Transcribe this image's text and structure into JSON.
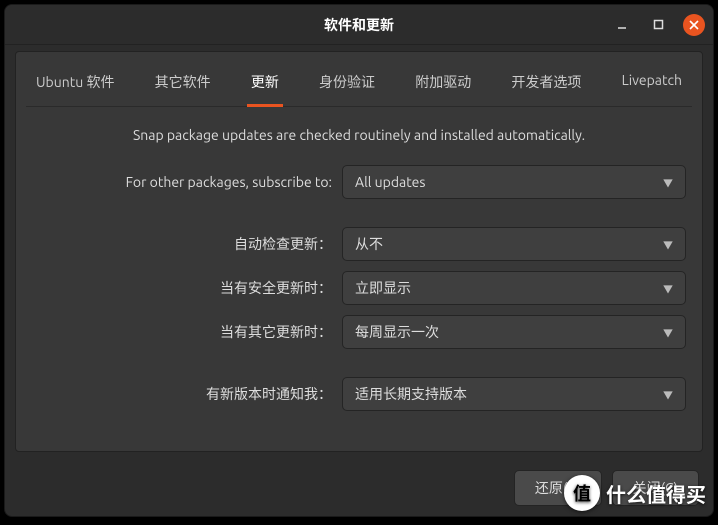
{
  "window": {
    "title": "软件和更新"
  },
  "tabs": [
    {
      "label": "Ubuntu 软件"
    },
    {
      "label": "其它软件"
    },
    {
      "label": "更新",
      "active": true
    },
    {
      "label": "身份验证"
    },
    {
      "label": "附加驱动"
    },
    {
      "label": "开发者选项"
    },
    {
      "label": "Livepatch"
    }
  ],
  "info": "Snap package updates are checked routinely and installed automatically.",
  "form": {
    "subscribe": {
      "label": "For other packages, subscribe to:",
      "value": "All updates"
    },
    "auto_check": {
      "label": "自动检查更新：",
      "value": "从不"
    },
    "security": {
      "label": "当有安全更新时：",
      "value": "立即显示"
    },
    "other_updates": {
      "label": "当有其它更新时：",
      "value": "每周显示一次"
    },
    "notify": {
      "label": "有新版本时通知我：",
      "value": "适用长期支持版本"
    }
  },
  "footer": {
    "revert": "还原(V)",
    "close": "关闭(C)"
  },
  "watermark": {
    "badge": "值",
    "text": "什么值得买"
  }
}
